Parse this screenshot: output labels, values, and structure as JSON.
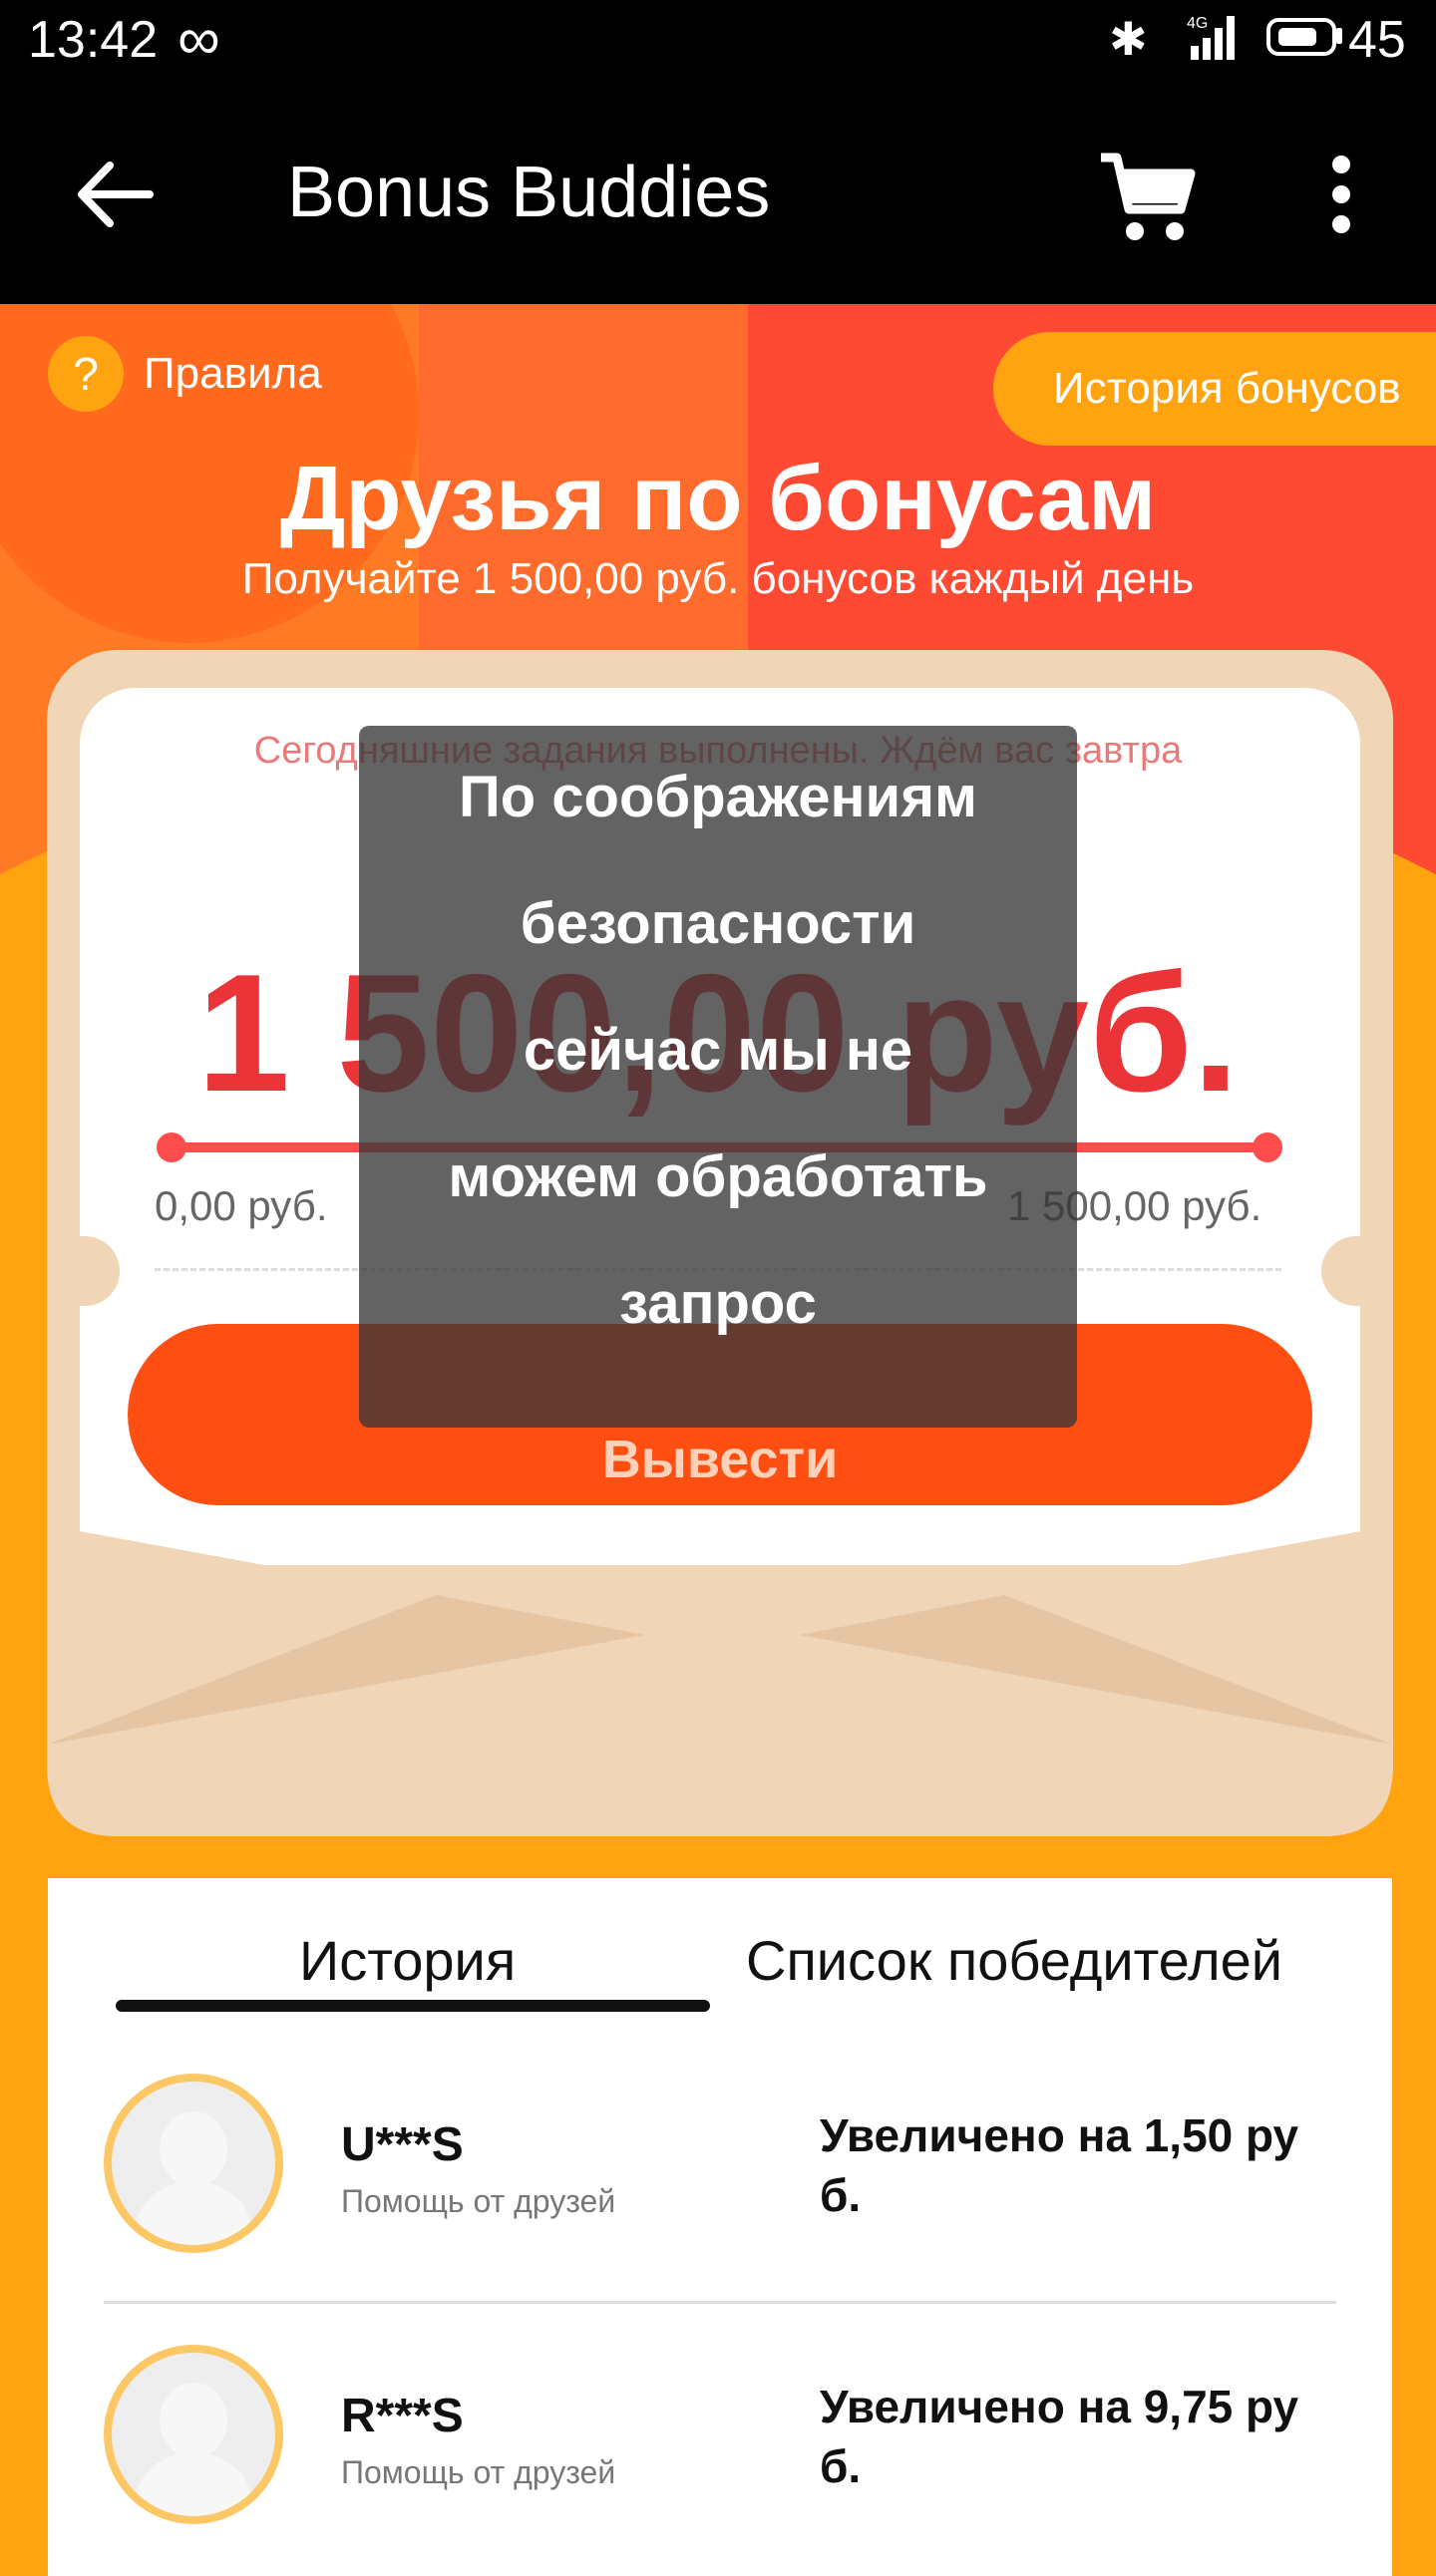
{
  "status_bar": {
    "time": "13:42",
    "infinity_icon": "∞",
    "bluetooth_icon": "✱",
    "network_type": "4G",
    "battery_level": "45"
  },
  "app_bar": {
    "title": "Bonus Buddies"
  },
  "hero": {
    "rules_label": "Правила",
    "rules_icon_glyph": "?",
    "history_button": "История бонусов",
    "title": "Друзья по бонусам",
    "subtitle": "Получайте 1 500,00 руб. бонусов каждый день"
  },
  "card": {
    "notice": "Сегодняшние задания выполнены. Ждём вас завтра",
    "amount": "1 500,00 руб.",
    "min_label": "0,00 руб.",
    "max_label": "1 500,00 руб.",
    "withdraw_label": "Вывести"
  },
  "toast": {
    "lines": [
      "По соображениям",
      "безопасности",
      "сейчас мы не",
      "можем обработать",
      "запрос"
    ]
  },
  "history_panel": {
    "tabs": [
      "История",
      "Список победителей"
    ],
    "active_tab": "История",
    "entries": [
      {
        "name": "U***S",
        "subtitle": "Помощь от друзей",
        "increase_line1": "Увеличено на 1,50 ру",
        "increase_line2": "б."
      },
      {
        "name": "R***S",
        "subtitle": "Помощь от друзей",
        "increase_line1": "Увеличено на 9,75 ру",
        "increase_line2": "б."
      }
    ]
  },
  "colors": {
    "accent": "#ffa310",
    "amount_red": "#ea3438",
    "button_orange": "#ff4e12",
    "avatar_ring": "#fcc765"
  }
}
